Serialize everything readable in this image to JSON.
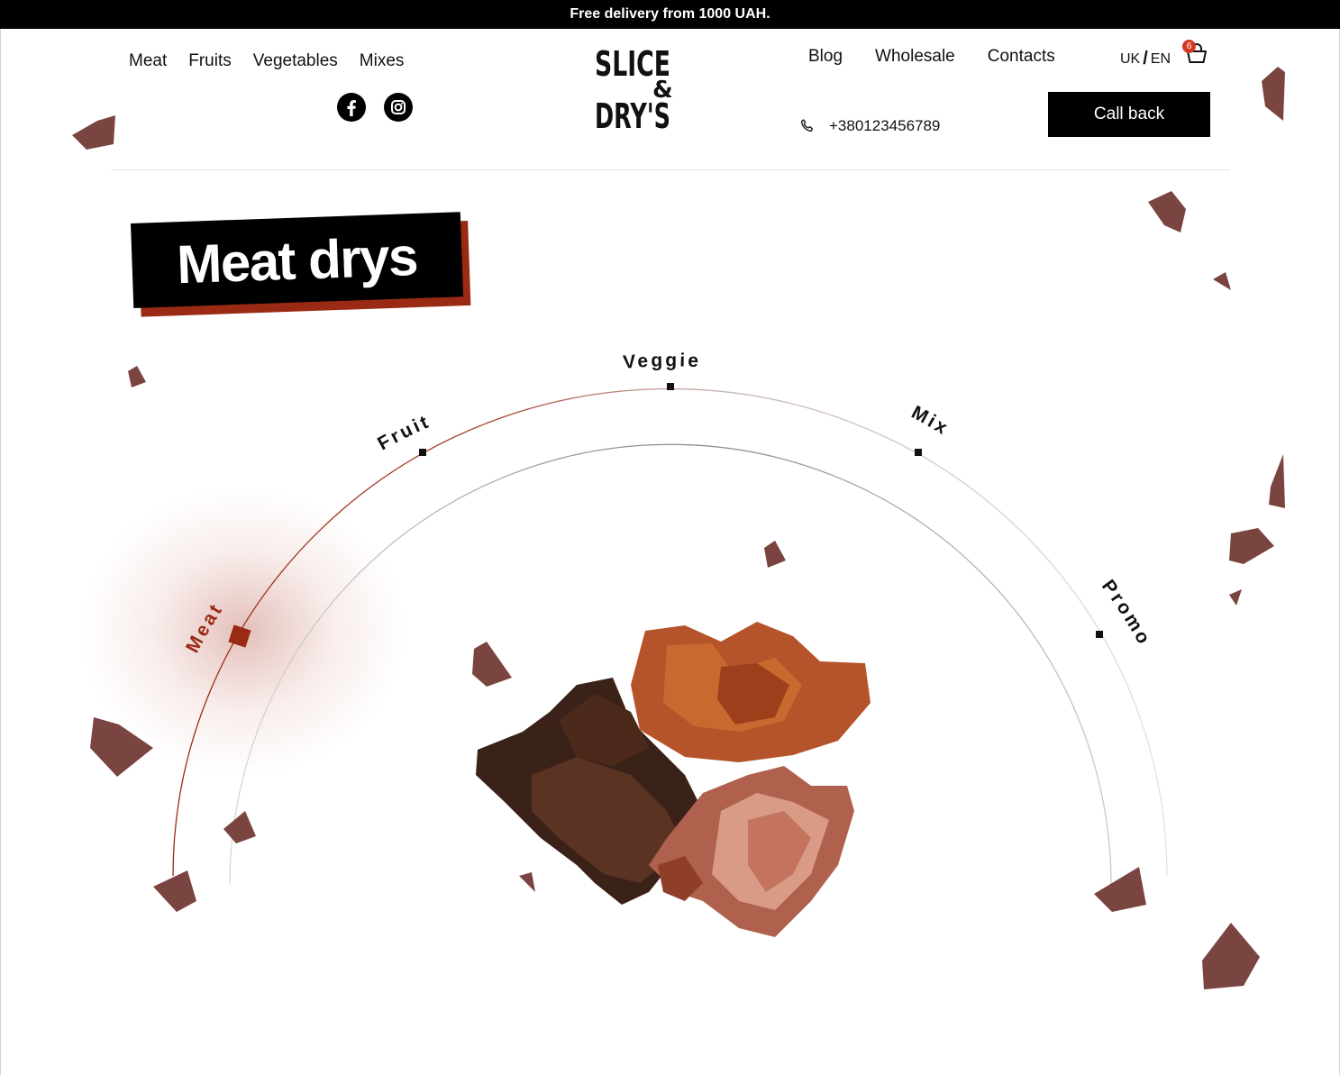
{
  "topbar": {
    "text": "Free delivery from 1000 UAH."
  },
  "nav_left": [
    "Meat",
    "Fruits",
    "Vegetables",
    "Mixes"
  ],
  "nav_right": [
    "Blog",
    "Wholesale",
    "Contacts"
  ],
  "logo": {
    "line1": "SLICE",
    "amp": "&",
    "line2": "DRY'S"
  },
  "lang": {
    "uk": "UK",
    "sep": "/",
    "en": "EN"
  },
  "cart": {
    "count": "6"
  },
  "phone": "+380123456789",
  "callback_label": "Call back",
  "hero_title": "Meat drys",
  "categories": [
    {
      "label": "Meat",
      "active": true
    },
    {
      "label": "Fruit",
      "active": false
    },
    {
      "label": "Veggie",
      "active": false
    },
    {
      "label": "Mix",
      "active": false
    },
    {
      "label": "Promo",
      "active": false
    }
  ],
  "colors": {
    "accent": "#9b2a14",
    "badge": "#d23a20",
    "meat": "#7a4440"
  },
  "icons": [
    "facebook-icon",
    "instagram-icon",
    "phone-icon",
    "cart-icon"
  ]
}
